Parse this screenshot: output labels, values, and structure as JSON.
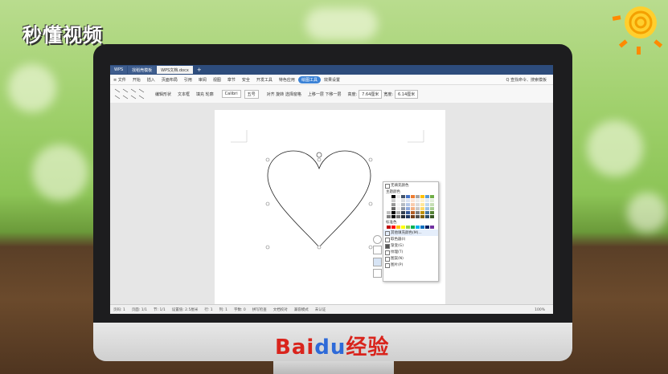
{
  "brand": {
    "watermark": "秒懂视频",
    "footer_logo_a": "Bai",
    "footer_logo_b": "du",
    "footer_logo_c": "经验"
  },
  "tabs": [
    {
      "label": "WPS"
    },
    {
      "label": "找稻壳模板"
    },
    {
      "label": "WPS文档.docx"
    }
  ],
  "menu": {
    "file": "≡ 文件",
    "items": [
      "开始",
      "插入",
      "页面布局",
      "引用",
      "审阅",
      "视图",
      "章节",
      "安全",
      "开发工具",
      "特色应用"
    ],
    "active": "绘图工具",
    "after": "效果设置",
    "search": "Q 查找命令、搜索模板"
  },
  "ribbon": {
    "edit_shape": "编辑形状",
    "text_box": "文本框",
    "fill": "填充",
    "outline": "轮廓",
    "font": "Calibri",
    "size": "五号",
    "align": "对齐",
    "rotate": "旋转",
    "select_pane": "选择窗格",
    "up_one": "上移一层",
    "down_one": "下移一层",
    "height_label": "高度:",
    "height_val": "7.64厘米",
    "width_label": "宽度:",
    "width_val": "6.14厘米"
  },
  "popup": {
    "no_fill": "无填充颜色",
    "theme_colors": "主题颜色",
    "standard_colors": "标准色",
    "more_colors": "其他填充颜色(M)...",
    "picker": "取色器(I)",
    "gradient": "渐变(G)",
    "texture": "纹理(T)",
    "pattern": "图案(N)",
    "picture": "图片(P)"
  },
  "status": {
    "page": "页码: 1",
    "pages": "页面: 1/1",
    "section": "节: 1/1",
    "setting": "设置值: 2.5厘米",
    "row": "行: 1",
    "col": "列: 1",
    "words": "字数: 0",
    "spell": "拼写检查",
    "doc_check": "文档校对",
    "compat": "兼容模式",
    "cert": "未认证",
    "zoom": "100%"
  },
  "colors": {
    "theme": [
      "#ffffff",
      "#000000",
      "#e7e6e6",
      "#44546a",
      "#4472c4",
      "#ed7d31",
      "#a5a5a5",
      "#ffc000",
      "#5b9bd5",
      "#70ad47"
    ],
    "standard": [
      "#c00000",
      "#ff0000",
      "#ffc000",
      "#ffff00",
      "#92d050",
      "#00b050",
      "#00b0f0",
      "#0070c0",
      "#002060",
      "#7030a0"
    ]
  }
}
